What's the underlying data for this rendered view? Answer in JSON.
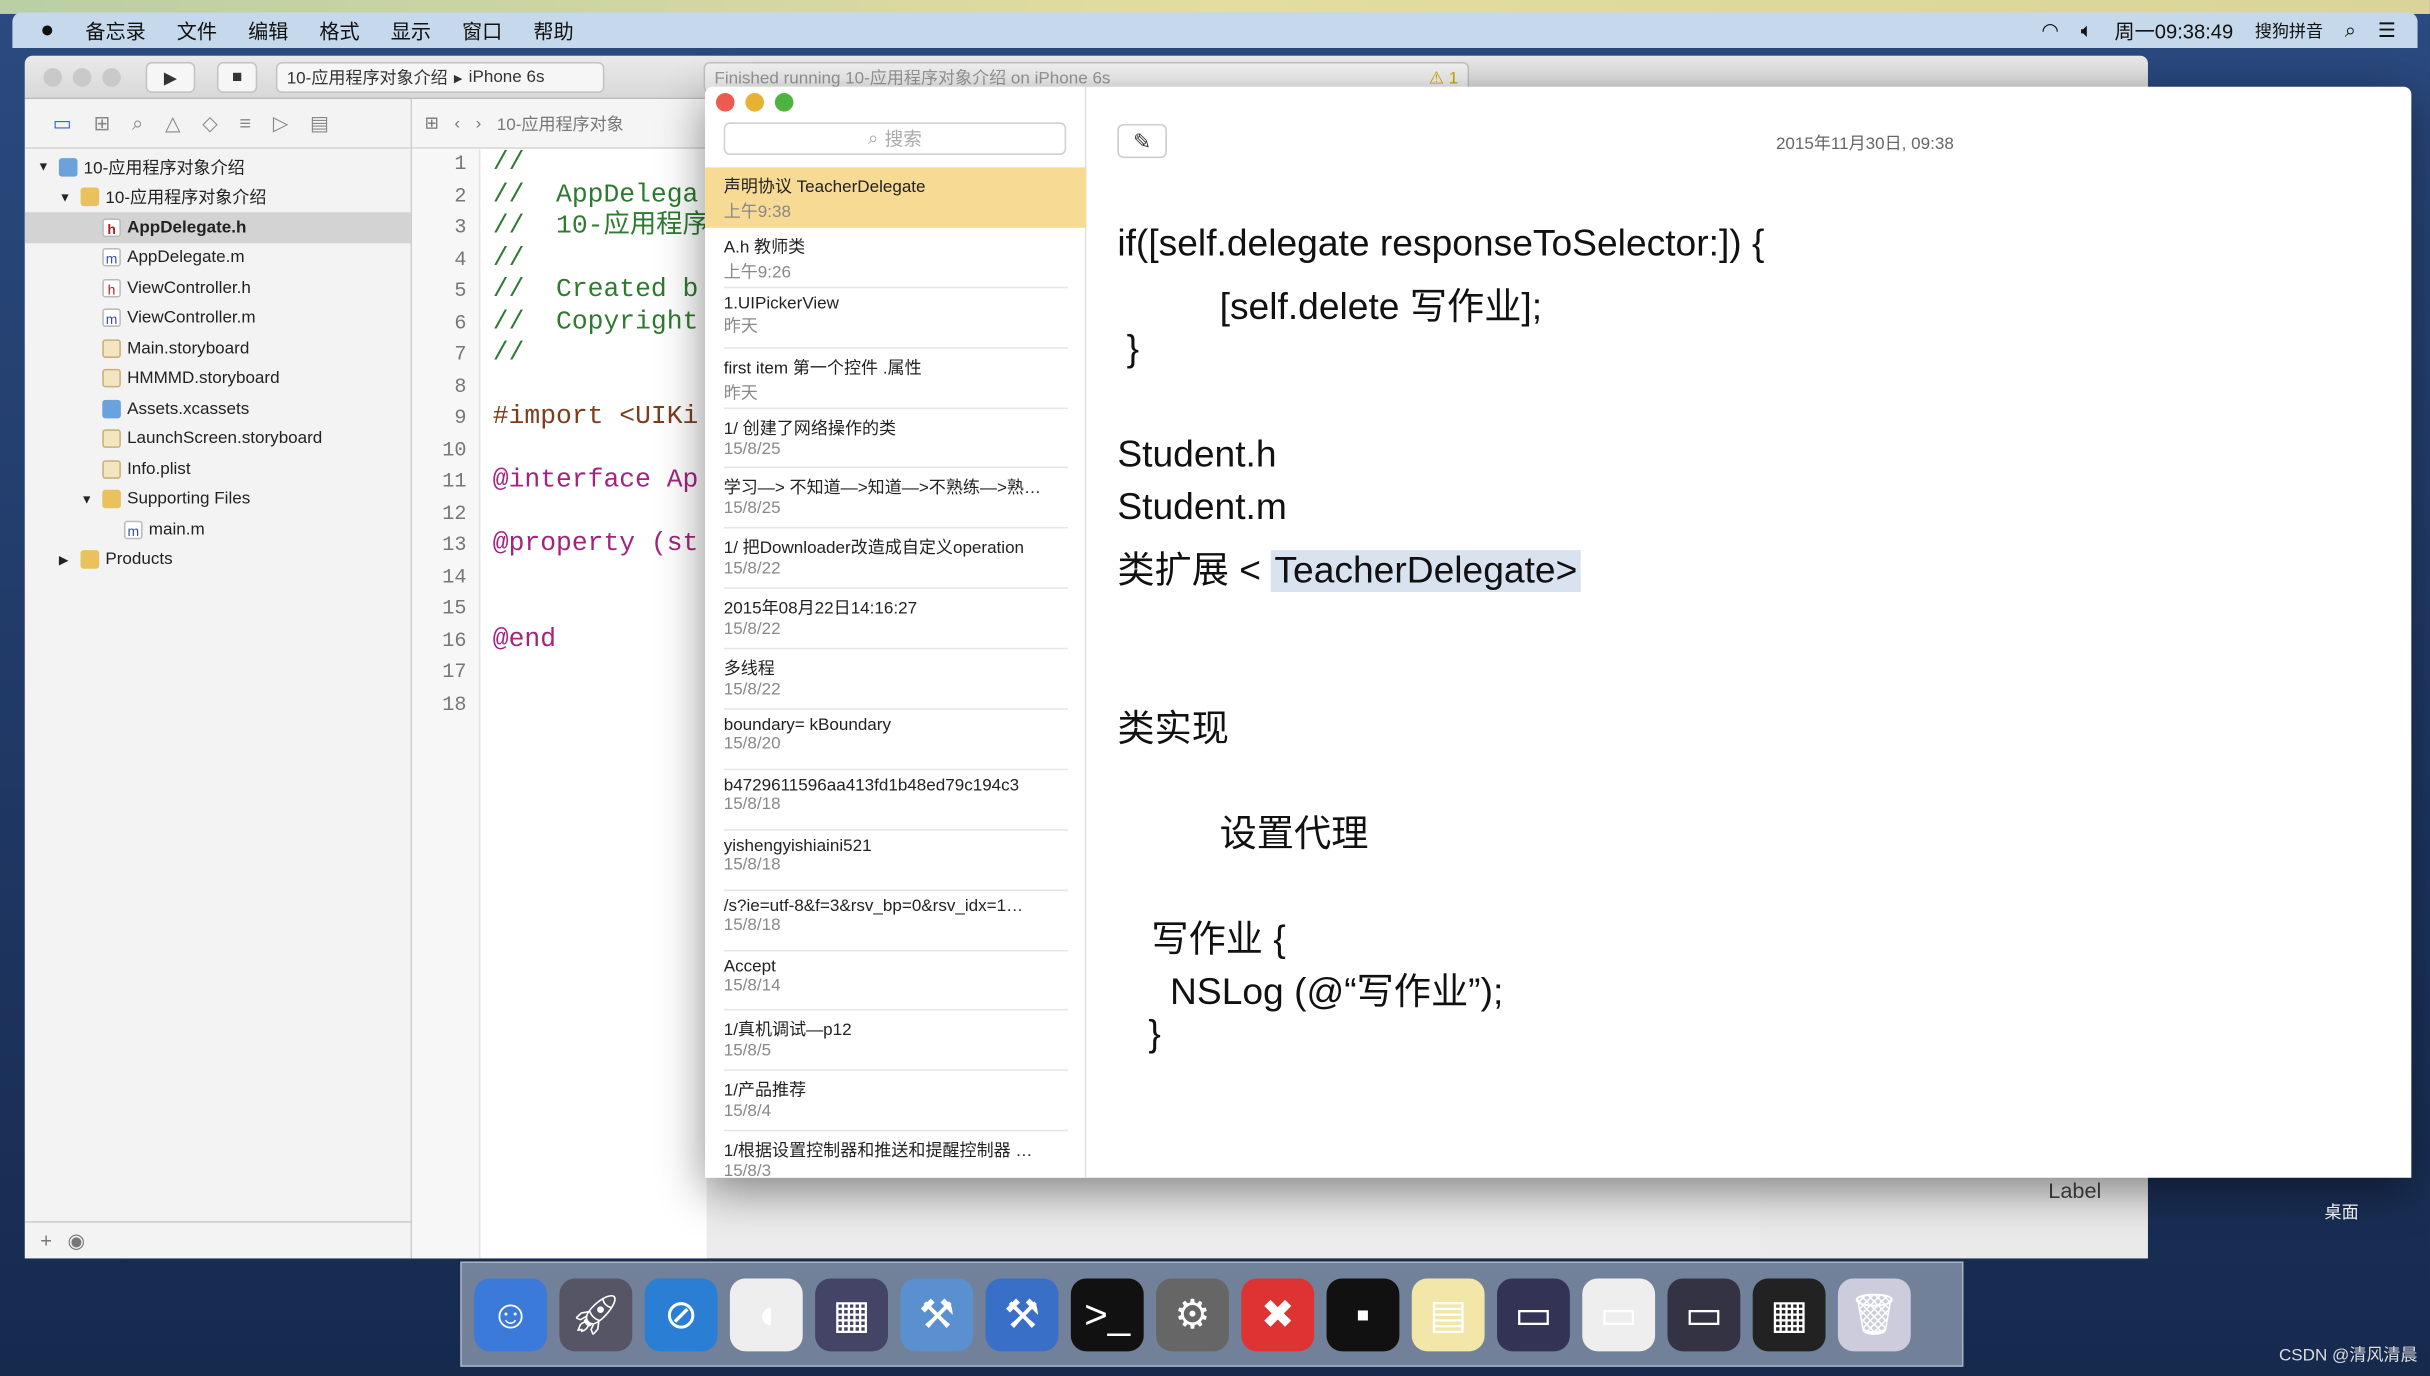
{
  "menubar": {
    "apple": "",
    "items": [
      "备忘录",
      "文件",
      "编辑",
      "格式",
      "显示",
      "窗口",
      "帮助"
    ],
    "clock": "周一09:38:49",
    "input_method": "搜狗拼音"
  },
  "xcode": {
    "scheme": "10-应用程序对象介绍",
    "device": "iPhone 6s",
    "status": "Finished running 10-应用程序对象介绍 on iPhone 6s",
    "warnings": "1",
    "jump_bar": "10-应用程序对象",
    "tree": [
      {
        "label": "10-应用程序对象介绍",
        "type": "project",
        "depth": 0,
        "disclosure": "▼"
      },
      {
        "label": "10-应用程序对象介绍",
        "type": "folder",
        "depth": 1,
        "disclosure": "▼"
      },
      {
        "label": "AppDelegate.h",
        "type": "h",
        "depth": 2,
        "selected": true
      },
      {
        "label": "AppDelegate.m",
        "type": "m",
        "depth": 2
      },
      {
        "label": "ViewController.h",
        "type": "h",
        "depth": 2
      },
      {
        "label": "ViewController.m",
        "type": "m",
        "depth": 2
      },
      {
        "label": "Main.storyboard",
        "type": "sb",
        "depth": 2
      },
      {
        "label": "HMMMD.storyboard",
        "type": "sb",
        "depth": 2
      },
      {
        "label": "Assets.xcassets",
        "type": "asset",
        "depth": 2
      },
      {
        "label": "LaunchScreen.storyboard",
        "type": "sb",
        "depth": 2
      },
      {
        "label": "Info.plist",
        "type": "sb",
        "depth": 2
      },
      {
        "label": "Supporting Files",
        "type": "folder",
        "depth": 2,
        "disclosure": "▼"
      },
      {
        "label": "main.m",
        "type": "m",
        "depth": 3
      },
      {
        "label": "Products",
        "type": "folder",
        "depth": 1,
        "disclosure": "▶"
      }
    ],
    "lines": [
      "1",
      "2",
      "3",
      "4",
      "5",
      "6",
      "7",
      "8",
      "9",
      "10",
      "11",
      "12",
      "13",
      "14",
      "15",
      "16",
      "17",
      "18"
    ],
    "code": [
      {
        "t": "//",
        "c": "cm"
      },
      {
        "t": "//  AppDelega",
        "c": "cm"
      },
      {
        "t": "//  10-应用程序",
        "c": "cm"
      },
      {
        "t": "//",
        "c": "cm"
      },
      {
        "t": "//  Created b",
        "c": "cm"
      },
      {
        "t": "//  Copyright",
        "c": "cm"
      },
      {
        "t": "//",
        "c": "cm"
      },
      {
        "t": "",
        "c": ""
      },
      {
        "t": "#import <UIKi",
        "c": "pp"
      },
      {
        "t": "",
        "c": ""
      },
      {
        "t": "@interface Ap",
        "c": "kw"
      },
      {
        "t": "",
        "c": ""
      },
      {
        "t": "@property (st",
        "c": "kw"
      },
      {
        "t": "",
        "c": ""
      },
      {
        "t": "",
        "c": ""
      },
      {
        "t": "@end",
        "c": "kw"
      },
      {
        "t": "",
        "c": ""
      },
      {
        "t": "",
        "c": ""
      }
    ],
    "ib_label": "Label"
  },
  "notes": {
    "search_placeholder": "搜索",
    "date": "2015年11月30日, 09:38",
    "items": [
      {
        "title": "声明协议 TeacherDelegate",
        "date": "上午9:38",
        "selected": true
      },
      {
        "title": "A.h  教师类",
        "date": "上午9:26"
      },
      {
        "title": "1.UIPickerView",
        "date": "昨天"
      },
      {
        "title": "first item 第一个控件 .属性",
        "date": "昨天"
      },
      {
        "title": "1/ 创建了网络操作的类",
        "date": "15/8/25"
      },
      {
        "title": "学习—> 不知道—>知道—>不熟练—>熟…",
        "date": "15/8/25"
      },
      {
        "title": "1/ 把Downloader改造成自定义operation",
        "date": "15/8/22"
      },
      {
        "title": "2015年08月22日14:16:27",
        "date": "15/8/22"
      },
      {
        "title": "多线程",
        "date": "15/8/22"
      },
      {
        "title": "boundary= kBoundary",
        "date": "15/8/20"
      },
      {
        "title": "b4729611596aa413fd1b48ed79c194c3",
        "date": "15/8/18"
      },
      {
        "title": "yishengyishiaini521",
        "date": "15/8/18"
      },
      {
        "title": "/s?ie=utf-8&f=3&rsv_bp=0&rsv_idx=1…",
        "date": "15/8/18"
      },
      {
        "title": "Accept",
        "date": "15/8/14"
      },
      {
        "title": "1/真机调试—p12",
        "date": "15/8/5"
      },
      {
        "title": "1/产品推荐",
        "date": "15/8/4"
      },
      {
        "title": "1/根据设置控制器和推送和提醒控制器 …",
        "date": "15/8/3"
      }
    ],
    "body": {
      "l1": "if([self.delegate responseToSelector:]) {",
      "l2": "[self.delete 写作业];",
      "l3": "}",
      "l4": "Student.h",
      "l5": "Student.m",
      "l6a": "类扩展 < ",
      "l6b": "TeacherDelegate>",
      "l7": "类实现",
      "l8": "设置代理",
      "l9": "写作业 {",
      "l10": "NSLog (@“写作业”);",
      "l11": "}"
    }
  },
  "desktop_label": "桌面",
  "watermark": "CSDN @清风清晨",
  "dock": [
    "finder",
    "launchpad",
    "safari",
    "mouse",
    "photo-booth",
    "xcode",
    "instruments",
    "terminal",
    "system-preferences",
    "xmind",
    "console",
    "notes",
    "screens",
    "preview",
    "display",
    "calculator",
    "trash"
  ]
}
